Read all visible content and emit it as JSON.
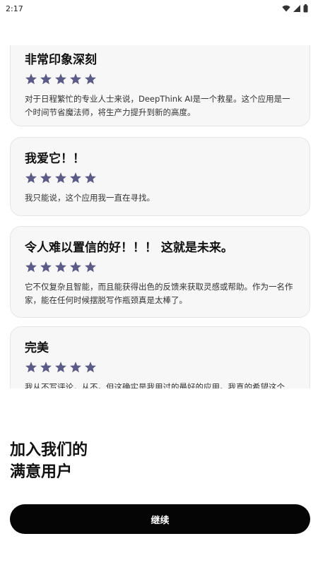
{
  "status_bar": {
    "time": "2:17",
    "icons": [
      "wifi-icon",
      "signal-icon",
      "battery-icon"
    ]
  },
  "reviews": [
    {
      "title": "非常印象深刻",
      "rating": 5,
      "body": "对于日程繁忙的专业人士来说，DeepThink AI是一个救星。这个应用是一个时间节省魔法师，将生产力提升到新的高度。"
    },
    {
      "title": "我爱它！！",
      "rating": 5,
      "body": "我只能说，这个应用我一直在寻找。"
    },
    {
      "title": "令人难以置信的好！！！ 这就是未来。",
      "rating": 5,
      "body": "它不仅复杂且智能，而且能获得出色的反馈来获取灵感或帮助。作为一名作家，能在任何时候摆脱写作瓶颈真是太棒了。"
    },
    {
      "title": "完美",
      "rating": 5,
      "body": "我从不写评论，从不。但这确实是我用过的最好的应用。我真的希望这个"
    }
  ],
  "join": {
    "line1": "加入我们的",
    "line2": "满意用户"
  },
  "continue_button": {
    "label": "继续"
  },
  "colors": {
    "star": "#5c5a86",
    "card_bg": "#f7f7f8",
    "button_bg": "#050505"
  }
}
